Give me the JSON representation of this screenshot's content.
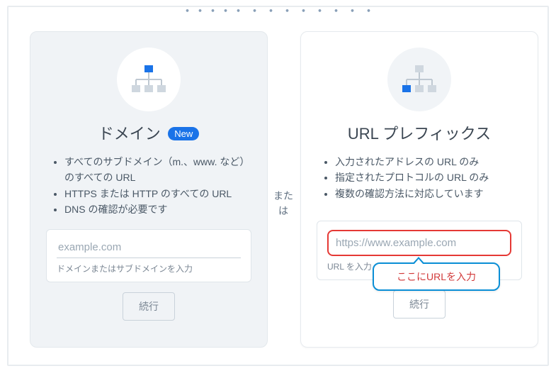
{
  "partial_header": "・・・・・  ・  ・  ・  ・  ・  ・  ・  ・ ",
  "separator": "または",
  "domain_card": {
    "title": "ドメイン",
    "badge": "New",
    "features": [
      "すべてのサブドメイン（m.、www. など）のすべての URL",
      "HTTPS または HTTP のすべての URL",
      "DNS の確認が必要です"
    ],
    "placeholder": "example.com",
    "help": "ドメインまたはサブドメインを入力",
    "continue": "続行"
  },
  "prefix_card": {
    "title": "URL プレフィックス",
    "features": [
      "入力されたアドレスの URL のみ",
      "指定されたプロトコルの URL のみ",
      "複数の確認方法に対応しています"
    ],
    "placeholder": "https://www.example.com",
    "help": "URL を入力",
    "continue": "続行"
  },
  "callout_text": "ここにURLを入力"
}
